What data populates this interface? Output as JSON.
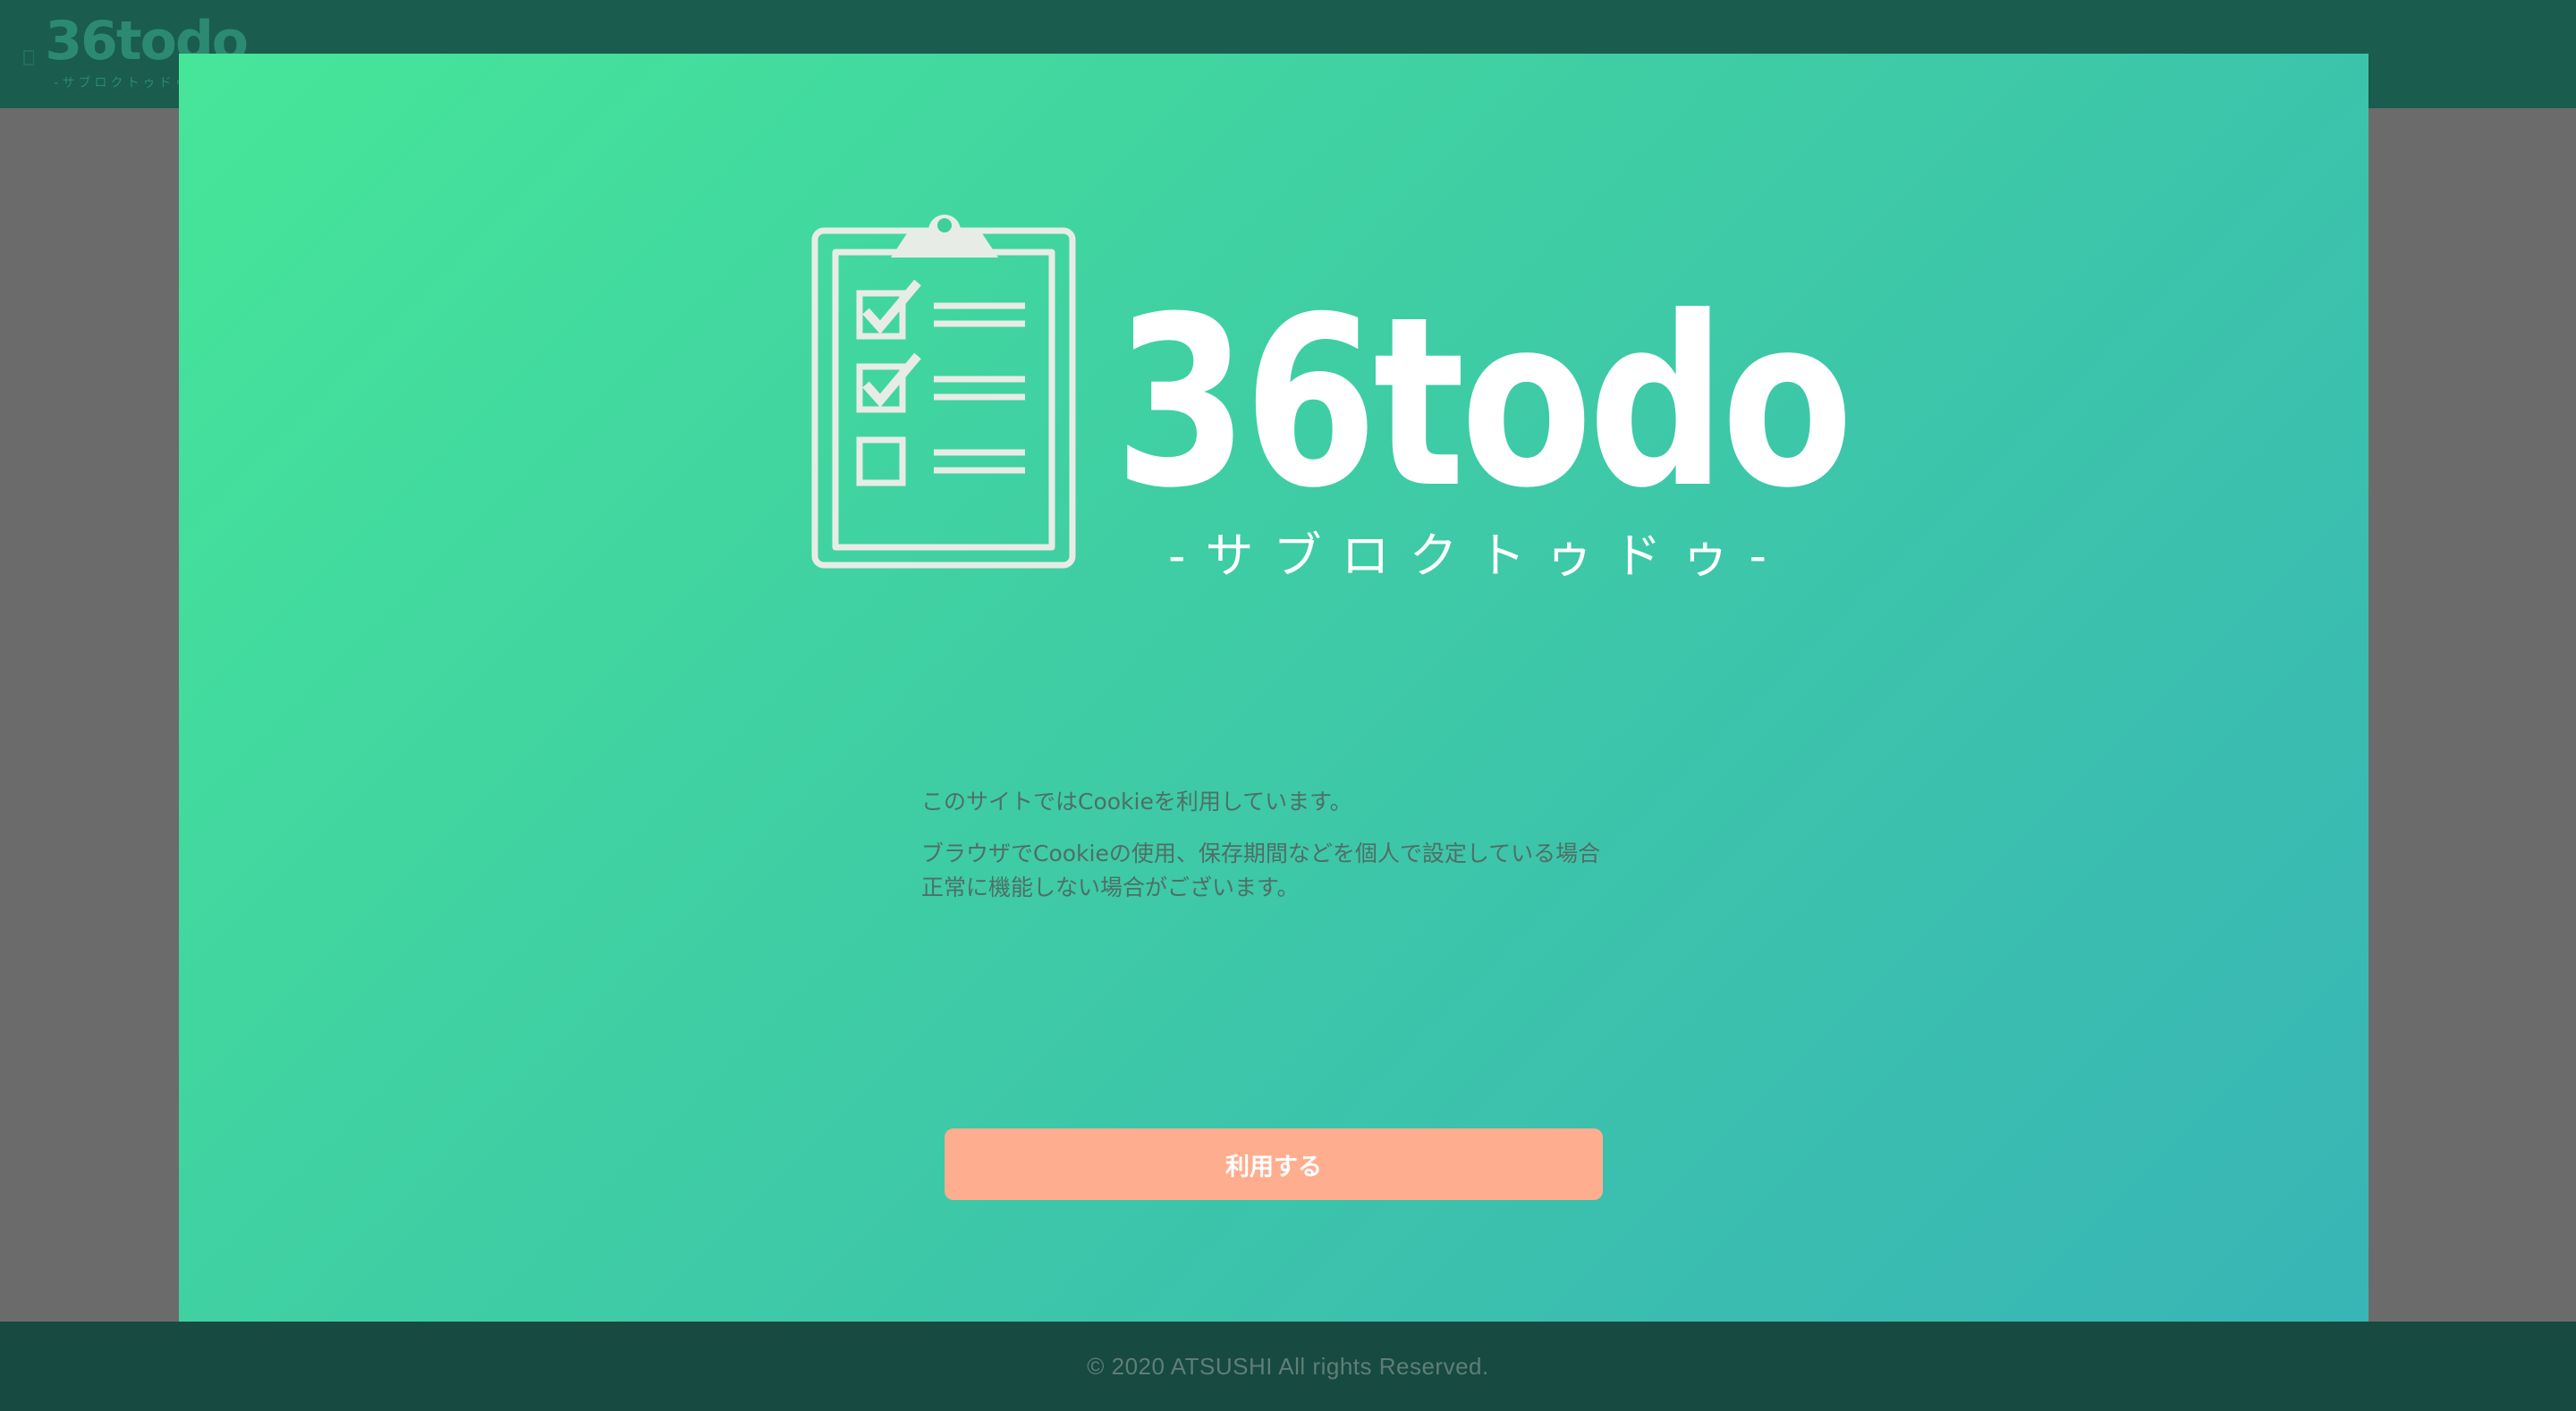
{
  "header": {
    "logo_title": "36todo",
    "logo_subtitle": "-サブロクトゥドゥ-"
  },
  "modal": {
    "logo_title": "36todo",
    "logo_subtitle": "-サブロクトゥドゥ-",
    "message_line1": "このサイトではCookieを利用しています。",
    "message_line2": "ブラウザでCookieの使用、保存期間などを個人で設定している場合",
    "message_line3": "正常に機能しない場合がございます。",
    "accept_label": "利用する"
  },
  "footer": {
    "copyright": "© 2020 ATSUSHI All rights Reserved."
  },
  "colors": {
    "header_bg": "#1a5c4d",
    "footer_bg": "#174a40",
    "overlay": "#6b6b6b",
    "gradient_start": "#46e699",
    "gradient_end": "#38b5b6",
    "button_bg": "#ffad8f",
    "logo_ink": "#e8ece6"
  }
}
